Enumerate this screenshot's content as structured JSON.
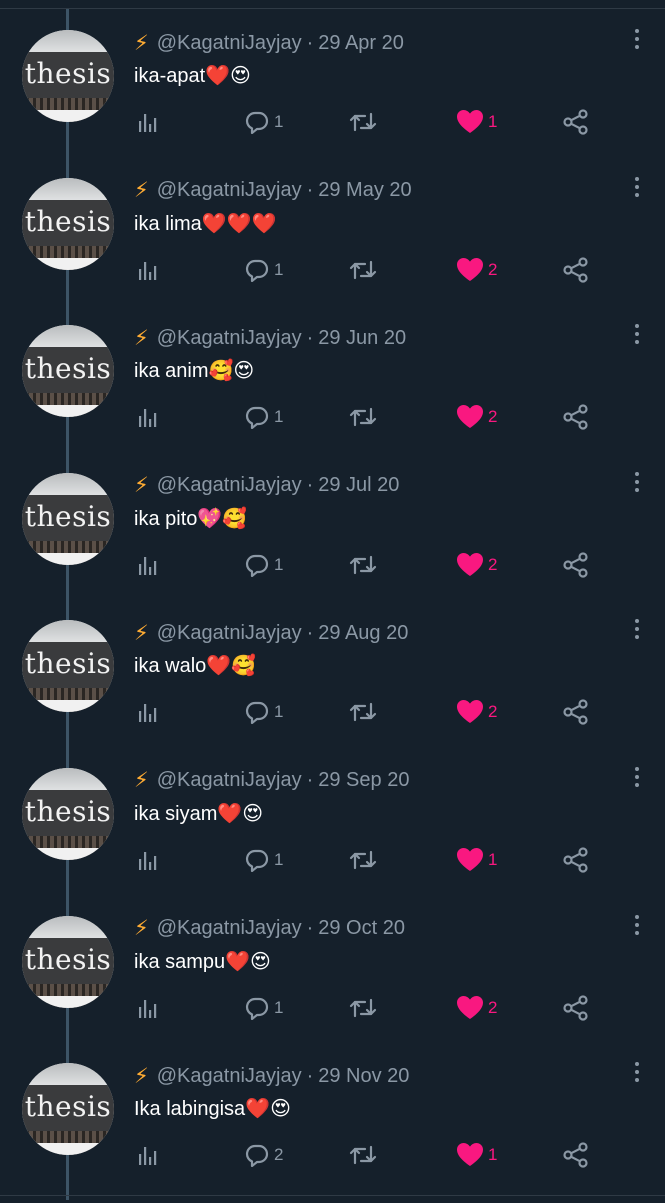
{
  "colors": {
    "background": "#15202b",
    "text": "#ffffff",
    "muted": "#8b98a5",
    "like": "#f91880",
    "thread_line": "#3d5466",
    "bolt": "#ffac33"
  },
  "icons": {
    "bolt": "⚡",
    "views": "bar-chart-icon",
    "reply": "reply-icon",
    "retweet": "retweet-icon",
    "like": "heart-icon",
    "share": "share-icon",
    "more": "more-icon"
  },
  "tweets": [
    {
      "avatar_text": "thesis",
      "handle": "@KagatniJayjay",
      "separator": "·",
      "date": "29 Apr 20",
      "text": "ika-apat",
      "emojis": "❤️😍",
      "replies": "1",
      "likes": "1"
    },
    {
      "avatar_text": "thesis",
      "handle": "@KagatniJayjay",
      "separator": "·",
      "date": "29 May 20",
      "text": "ika lima",
      "emojis": "❤️❤️❤️",
      "replies": "1",
      "likes": "2"
    },
    {
      "avatar_text": "thesis",
      "handle": "@KagatniJayjay",
      "separator": "·",
      "date": "29 Jun 20",
      "text": "ika anim",
      "emojis": "🥰😍",
      "replies": "1",
      "likes": "2"
    },
    {
      "avatar_text": "thesis",
      "handle": "@KagatniJayjay",
      "separator": "·",
      "date": "29 Jul 20",
      "text": "ika pito",
      "emojis": "💖🥰",
      "replies": "1",
      "likes": "2"
    },
    {
      "avatar_text": "thesis",
      "handle": "@KagatniJayjay",
      "separator": "·",
      "date": "29 Aug 20",
      "text": "ika walo",
      "emojis": "❤️🥰",
      "replies": "1",
      "likes": "2"
    },
    {
      "avatar_text": "thesis",
      "handle": "@KagatniJayjay",
      "separator": "·",
      "date": "29 Sep 20",
      "text": "ika siyam",
      "emojis": "❤️😍",
      "replies": "1",
      "likes": "1"
    },
    {
      "avatar_text": "thesis",
      "handle": "@KagatniJayjay",
      "separator": "·",
      "date": "29 Oct 20",
      "text": "ika sampu",
      "emojis": "❤️😍",
      "replies": "1",
      "likes": "2"
    },
    {
      "avatar_text": "thesis",
      "handle": "@KagatniJayjay",
      "separator": "·",
      "date": "29 Nov 20",
      "text": "Ika labingisa",
      "emojis": "❤️😍",
      "replies": "2",
      "likes": "1"
    }
  ]
}
